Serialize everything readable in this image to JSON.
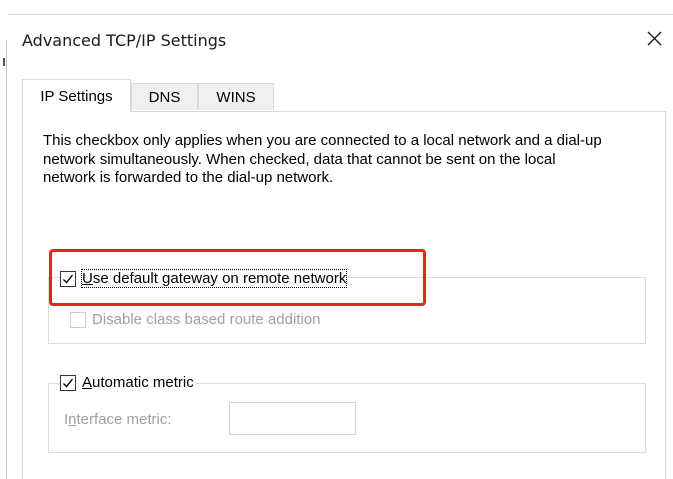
{
  "dialog": {
    "title": "Advanced TCP/IP Settings",
    "close_icon": "close-icon"
  },
  "tabs": [
    {
      "label": "IP Settings",
      "active": true
    },
    {
      "label": "DNS",
      "active": false
    },
    {
      "label": "WINS",
      "active": false
    }
  ],
  "ip_settings": {
    "description": "This checkbox only applies when you are connected to a local network and a dial-up network simultaneously.  When checked, data that cannot be sent on the local network is forwarded to the dial-up network.",
    "use_default_gateway": {
      "label_prefix": "",
      "label_underlined": "U",
      "label_rest": "se default gateway on remote network",
      "checked": true,
      "enabled": true
    },
    "disable_class_route": {
      "label": "Disable class based route addition",
      "checked": false,
      "enabled": false
    },
    "automatic_metric": {
      "label_underlined": "A",
      "label_rest": "utomatic metric",
      "checked": true,
      "enabled": true
    },
    "interface_metric": {
      "label_prefix": "I",
      "label_underlined": "n",
      "label_rest": "terface metric:",
      "value": "",
      "enabled": false
    }
  },
  "colors": {
    "highlight": "#e8231b",
    "disabled_text": "#a0a0a0"
  }
}
